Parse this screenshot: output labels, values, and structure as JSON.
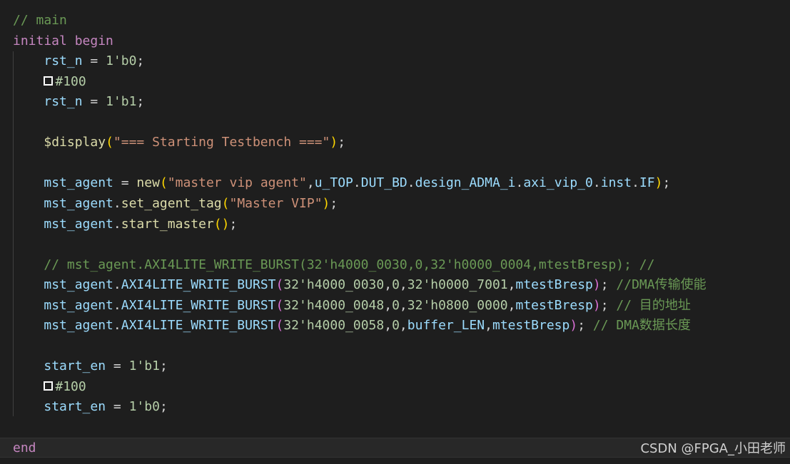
{
  "editor": {
    "lines": [
      [
        {
          "t": "// main",
          "c": "comment"
        }
      ],
      [
        {
          "t": "initial",
          "c": "keyword"
        },
        {
          "t": " ",
          "c": "plain"
        },
        {
          "t": "begin",
          "c": "keyword"
        }
      ],
      [
        {
          "t": "    ",
          "c": "plain"
        },
        {
          "t": "rst_n",
          "c": "var"
        },
        {
          "t": " = ",
          "c": "plain"
        },
        {
          "t": "1'b0",
          "c": "num"
        },
        {
          "t": ";",
          "c": "plain"
        }
      ],
      [
        {
          "t": "    ",
          "c": "plain"
        },
        {
          "t": "",
          "c": "box"
        },
        {
          "t": "#100",
          "c": "delay"
        }
      ],
      [
        {
          "t": "    ",
          "c": "plain"
        },
        {
          "t": "rst_n",
          "c": "var"
        },
        {
          "t": " = ",
          "c": "plain"
        },
        {
          "t": "1'b1",
          "c": "num"
        },
        {
          "t": ";",
          "c": "plain"
        }
      ],
      [],
      [
        {
          "t": "    ",
          "c": "plain"
        },
        {
          "t": "$display",
          "c": "fn"
        },
        {
          "t": "(",
          "c": "paren"
        },
        {
          "t": "\"=== Starting Testbench ===\"",
          "c": "str"
        },
        {
          "t": ")",
          "c": "paren"
        },
        {
          "t": ";",
          "c": "plain"
        }
      ],
      [],
      [
        {
          "t": "    ",
          "c": "plain"
        },
        {
          "t": "mst_agent",
          "c": "var"
        },
        {
          "t": " = ",
          "c": "plain"
        },
        {
          "t": "new",
          "c": "fn"
        },
        {
          "t": "(",
          "c": "paren"
        },
        {
          "t": "\"master vip agent\"",
          "c": "str"
        },
        {
          "t": ",",
          "c": "plain"
        },
        {
          "t": "u_TOP",
          "c": "var"
        },
        {
          "t": ".",
          "c": "plain"
        },
        {
          "t": "DUT_BD",
          "c": "var"
        },
        {
          "t": ".",
          "c": "plain"
        },
        {
          "t": "design_ADMA_i",
          "c": "var"
        },
        {
          "t": ".",
          "c": "plain"
        },
        {
          "t": "axi_vip_0",
          "c": "var"
        },
        {
          "t": ".",
          "c": "plain"
        },
        {
          "t": "inst",
          "c": "var"
        },
        {
          "t": ".",
          "c": "plain"
        },
        {
          "t": "IF",
          "c": "var"
        },
        {
          "t": ")",
          "c": "paren"
        },
        {
          "t": ";",
          "c": "plain"
        }
      ],
      [
        {
          "t": "    ",
          "c": "plain"
        },
        {
          "t": "mst_agent",
          "c": "var"
        },
        {
          "t": ".",
          "c": "plain"
        },
        {
          "t": "set_agent_tag",
          "c": "fn"
        },
        {
          "t": "(",
          "c": "paren"
        },
        {
          "t": "\"Master VIP\"",
          "c": "str"
        },
        {
          "t": ")",
          "c": "paren"
        },
        {
          "t": ";",
          "c": "plain"
        }
      ],
      [
        {
          "t": "    ",
          "c": "plain"
        },
        {
          "t": "mst_agent",
          "c": "var"
        },
        {
          "t": ".",
          "c": "plain"
        },
        {
          "t": "start_master",
          "c": "fn"
        },
        {
          "t": "()",
          "c": "paren"
        },
        {
          "t": ";",
          "c": "plain"
        }
      ],
      [],
      [
        {
          "t": "    ",
          "c": "plain"
        },
        {
          "t": "// mst_agent.AXI4LITE_WRITE_BURST(32'h4000_0030,0,32'h0000_0004,mtestBresp); //",
          "c": "comment"
        }
      ],
      [
        {
          "t": "    ",
          "c": "plain"
        },
        {
          "t": "mst_agent",
          "c": "var"
        },
        {
          "t": ".",
          "c": "plain"
        },
        {
          "t": "AXI4LITE_WRITE_BURST",
          "c": "var"
        },
        {
          "t": "(",
          "c": "paren2"
        },
        {
          "t": "32'h4000_0030",
          "c": "num"
        },
        {
          "t": ",",
          "c": "plain"
        },
        {
          "t": "0",
          "c": "num"
        },
        {
          "t": ",",
          "c": "plain"
        },
        {
          "t": "32'h0000_7001",
          "c": "num"
        },
        {
          "t": ",",
          "c": "plain"
        },
        {
          "t": "mtestBresp",
          "c": "var"
        },
        {
          "t": ")",
          "c": "paren2"
        },
        {
          "t": "; ",
          "c": "plain"
        },
        {
          "t": "//DMA传输使能",
          "c": "comment"
        }
      ],
      [
        {
          "t": "    ",
          "c": "plain"
        },
        {
          "t": "mst_agent",
          "c": "var"
        },
        {
          "t": ".",
          "c": "plain"
        },
        {
          "t": "AXI4LITE_WRITE_BURST",
          "c": "var"
        },
        {
          "t": "(",
          "c": "paren2"
        },
        {
          "t": "32'h4000_0048",
          "c": "num"
        },
        {
          "t": ",",
          "c": "plain"
        },
        {
          "t": "0",
          "c": "num"
        },
        {
          "t": ",",
          "c": "plain"
        },
        {
          "t": "32'h0800_0000",
          "c": "num"
        },
        {
          "t": ",",
          "c": "plain"
        },
        {
          "t": "mtestBresp",
          "c": "var"
        },
        {
          "t": ")",
          "c": "paren2"
        },
        {
          "t": "; ",
          "c": "plain"
        },
        {
          "t": "// 目的地址",
          "c": "comment"
        }
      ],
      [
        {
          "t": "    ",
          "c": "plain"
        },
        {
          "t": "mst_agent",
          "c": "var"
        },
        {
          "t": ".",
          "c": "plain"
        },
        {
          "t": "AXI4LITE_WRITE_BURST",
          "c": "var"
        },
        {
          "t": "(",
          "c": "paren2"
        },
        {
          "t": "32'h4000_0058",
          "c": "num"
        },
        {
          "t": ",",
          "c": "plain"
        },
        {
          "t": "0",
          "c": "num"
        },
        {
          "t": ",",
          "c": "plain"
        },
        {
          "t": "buffer_LEN",
          "c": "var"
        },
        {
          "t": ",",
          "c": "plain"
        },
        {
          "t": "mtestBresp",
          "c": "var"
        },
        {
          "t": ")",
          "c": "paren2"
        },
        {
          "t": "; ",
          "c": "plain"
        },
        {
          "t": "// DMA数据长度",
          "c": "comment"
        }
      ],
      [],
      [
        {
          "t": "    ",
          "c": "plain"
        },
        {
          "t": "start_en",
          "c": "var"
        },
        {
          "t": " = ",
          "c": "plain"
        },
        {
          "t": "1'b1",
          "c": "num"
        },
        {
          "t": ";",
          "c": "plain"
        }
      ],
      [
        {
          "t": "    ",
          "c": "plain"
        },
        {
          "t": "",
          "c": "box"
        },
        {
          "t": "#100",
          "c": "delay"
        }
      ],
      [
        {
          "t": "    ",
          "c": "plain"
        },
        {
          "t": "start_en",
          "c": "var"
        },
        {
          "t": " = ",
          "c": "plain"
        },
        {
          "t": "1'b0",
          "c": "num"
        },
        {
          "t": ";",
          "c": "plain"
        }
      ],
      [],
      [
        {
          "t": "end",
          "c": "keyword"
        }
      ]
    ]
  },
  "watermark": "CSDN @FPGA_小田老师"
}
